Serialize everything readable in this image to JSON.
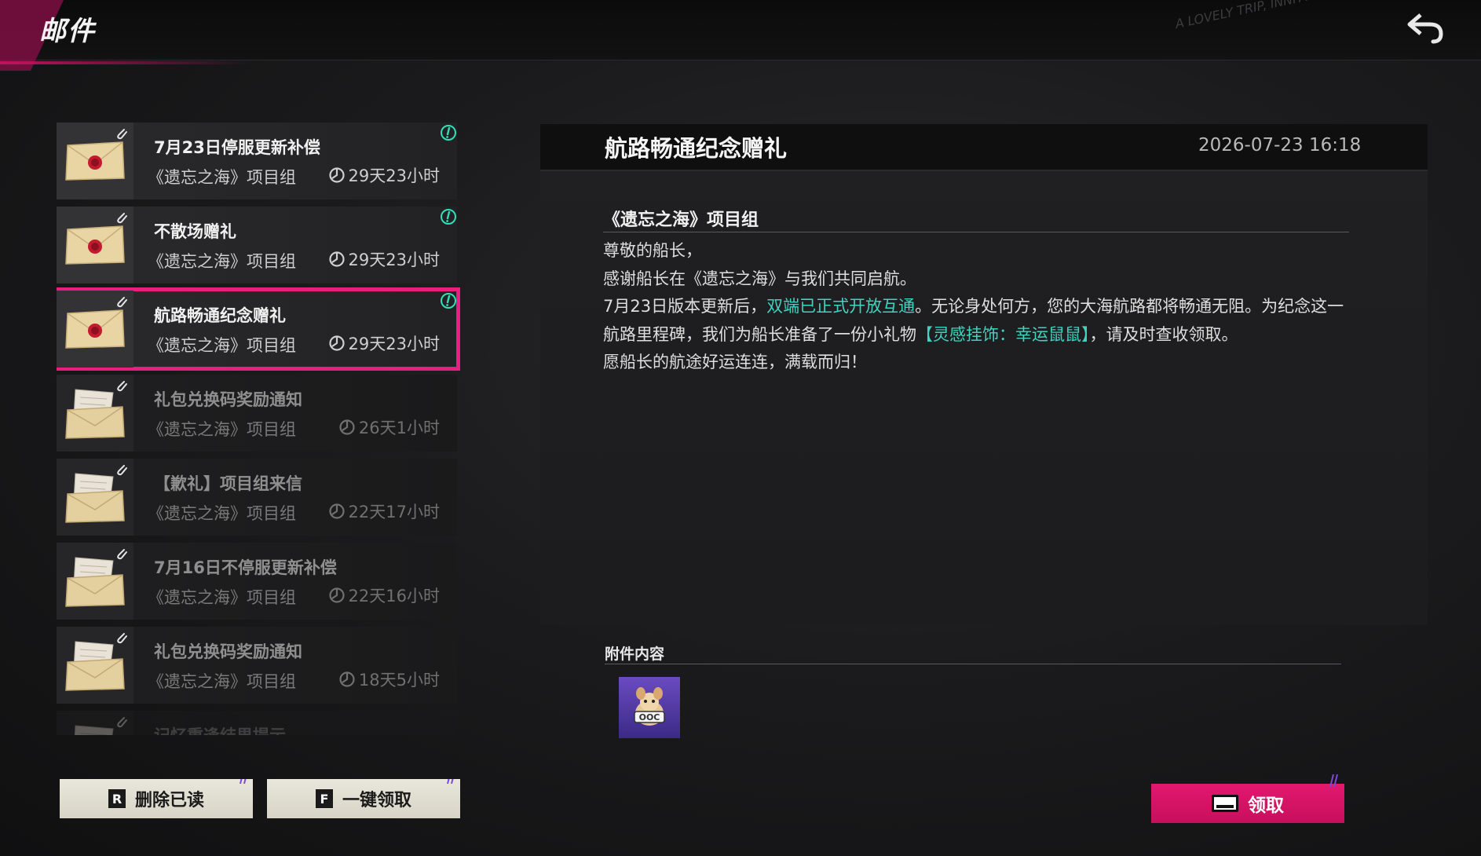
{
  "header": {
    "title": "邮件",
    "deco_text": "A LOVELY TRIP, INNIT?"
  },
  "mails": [
    {
      "title": "7月23日停服更新补偿",
      "sender": "《遗忘之海》项目组",
      "time_left": "29天23小时",
      "read": false,
      "unread_mark": true
    },
    {
      "title": "不散场赠礼",
      "sender": "《遗忘之海》项目组",
      "time_left": "29天23小时",
      "read": false,
      "unread_mark": true
    },
    {
      "title": "航路畅通纪念赠礼",
      "sender": "《遗忘之海》项目组",
      "time_left": "29天23小时",
      "read": false,
      "unread_mark": true,
      "selected": true
    },
    {
      "title": "礼包兑换码奖励通知",
      "sender": "《遗忘之海》项目组",
      "time_left": "26天1小时",
      "read": true,
      "unread_mark": false
    },
    {
      "title": "【歉礼】项目组来信",
      "sender": "《遗忘之海》项目组",
      "time_left": "22天17小时",
      "read": true,
      "unread_mark": false
    },
    {
      "title": "7月16日不停服更新补偿",
      "sender": "《遗忘之海》项目组",
      "time_left": "22天16小时",
      "read": true,
      "unread_mark": false
    },
    {
      "title": "礼包兑换码奖励通知",
      "sender": "《遗忘之海》项目组",
      "time_left": "18天5小时",
      "read": true,
      "unread_mark": false
    },
    {
      "title": "记忆重逢结果提示",
      "sender": "",
      "time_left": "",
      "read": true,
      "unread_mark": false
    }
  ],
  "buttons": {
    "delete_read": {
      "key": "R",
      "label": "删除已读"
    },
    "claim_all": {
      "key": "F",
      "label": "一键领取"
    },
    "claim": {
      "label": "领取"
    }
  },
  "detail": {
    "title": "航路畅通纪念赠礼",
    "date": "2026-07-23 16:18",
    "sender": "《遗忘之海》项目组",
    "greeting": "尊敬的船长，",
    "line1": "感谢船长在《遗忘之海》与我们共同启航。",
    "line2_a": "7月23日版本更新后，",
    "line2_hl": "双端已正式开放互通",
    "line2_b": "。无论身处何方，您的大海航路都将畅通无阻。为纪念这一航路里程碑，我们为船长准备了一份小礼物",
    "line2_hl2": "【灵感挂饰：幸运鼠鼠】",
    "line2_c": "，请及时查收领取。",
    "closing": "愿船长的航途好运连连，满载而归！",
    "attachment_label": "附件内容",
    "attachment_icon": "lucky-mouse-charm-icon"
  },
  "colors": {
    "accent": "#ea1e7e",
    "highlight_text": "#3fd3c0",
    "unread_mark": "#2fe0b8",
    "attachment_bg": "#5a3fb0"
  }
}
